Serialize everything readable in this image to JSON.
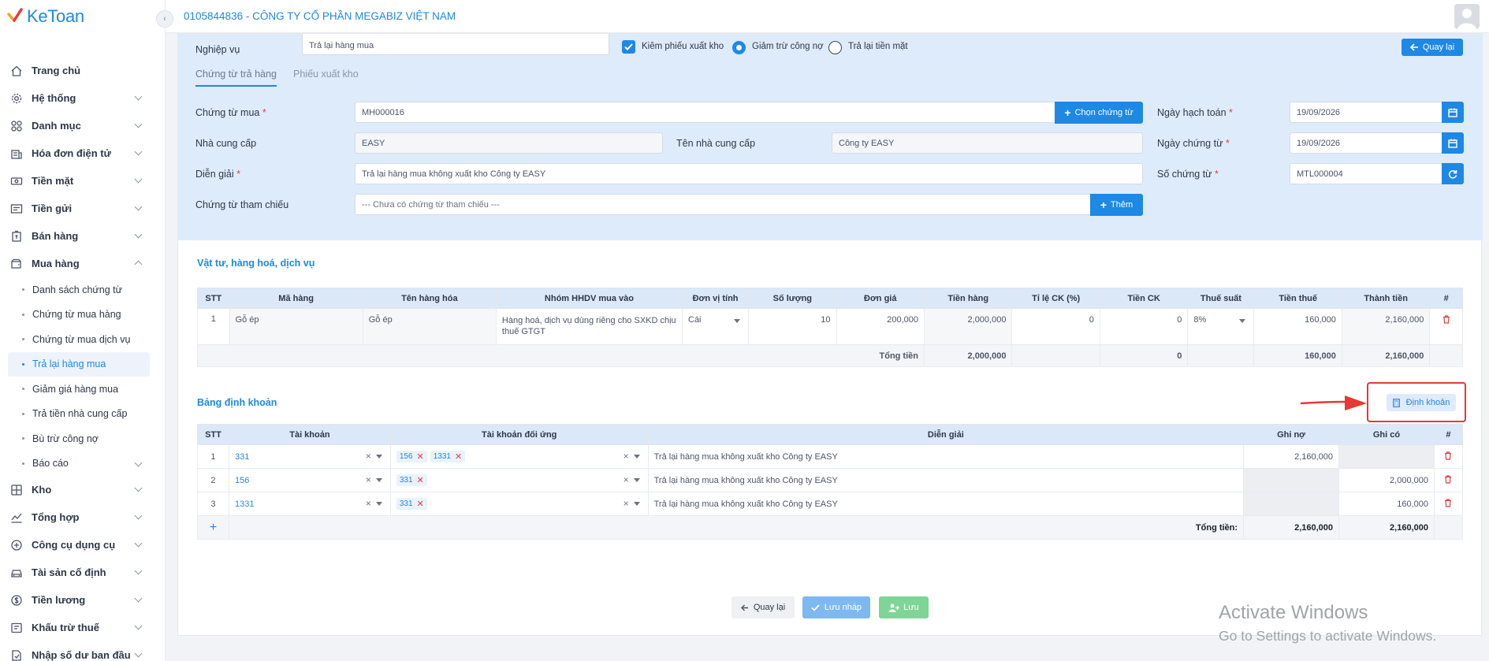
{
  "app": {
    "logo_text": "KeToan",
    "company_title": "0105844836 - CÔNG TY CỔ PHẦN MEGABIZ VIỆT NAM"
  },
  "sidebar": {
    "items": [
      {
        "label": "Trang chủ",
        "icon": "home-icon"
      },
      {
        "label": "Hệ thống",
        "icon": "gear-icon"
      },
      {
        "label": "Danh mục",
        "icon": "grid-icon"
      },
      {
        "label": "Hóa đơn điện tử",
        "icon": "invoice-icon"
      },
      {
        "label": "Tiền mặt",
        "icon": "cash-icon"
      },
      {
        "label": "Tiền gửi",
        "icon": "bank-icon"
      },
      {
        "label": "Bán hàng",
        "icon": "sales-icon"
      },
      {
        "label": "Mua hàng",
        "icon": "purchase-icon"
      }
    ],
    "sub_items": [
      {
        "label": "Danh sách chứng từ"
      },
      {
        "label": "Chứng từ mua hàng"
      },
      {
        "label": "Chứng từ mua dịch vụ"
      },
      {
        "label": "Trả lại hàng mua"
      },
      {
        "label": "Giảm giá hàng mua"
      },
      {
        "label": "Trả tiền nhà cung cấp"
      },
      {
        "label": "Bù trừ công nợ"
      },
      {
        "label": "Báo cáo"
      }
    ],
    "items_after": [
      {
        "label": "Kho",
        "icon": "warehouse-icon"
      },
      {
        "label": "Tổng hợp",
        "icon": "chart-icon"
      },
      {
        "label": "Công cụ dụng cụ",
        "icon": "tools-icon"
      },
      {
        "label": "Tài sản cố định",
        "icon": "asset-icon"
      },
      {
        "label": "Tiền lương",
        "icon": "salary-icon"
      },
      {
        "label": "Khấu trừ thuế",
        "icon": "tax-icon"
      },
      {
        "label": "Nhập số dư ban đầu",
        "icon": "balance-icon"
      }
    ]
  },
  "form": {
    "nghiep_vu_label": "Nghiệp vụ",
    "nghiep_vu_value": "Trả lại hàng mua",
    "kiem_phieu_label": "Kiêm phiếu xuất kho",
    "giam_tru_label": "Giảm trừ công nợ",
    "tra_lai_label": "Trả lại tiền mặt",
    "back_top_label": "Quay lại",
    "tabs": [
      "Chứng từ trả hàng",
      "Phiếu xuất kho"
    ],
    "chung_tu_mua_label": "Chứng từ mua",
    "chung_tu_mua_value": "MH000016",
    "chon_chung_tu_label": "Chọn chứng từ",
    "ngay_hach_toan_label": "Ngày hạch toán",
    "ngay_hach_toan_value": "19/09/2026",
    "nha_cung_cap_label": "Nhà cung cấp",
    "nha_cung_cap_value": "EASY",
    "ten_ncc_label": "Tên nhà cung cấp",
    "ten_ncc_value": "Công ty EASY",
    "ngay_chung_tu_label": "Ngày chứng từ",
    "ngay_chung_tu_value": "19/09/2026",
    "dien_giai_label": "Diễn giải",
    "dien_giai_value": "Trả lại hàng mua không xuất kho Công ty EASY",
    "so_chung_tu_label": "Số chứng từ",
    "so_chung_tu_value": "MTL000004",
    "tham_chieu_label": "Chứng từ tham chiếu",
    "tham_chieu_value": "--- Chưa có chứng từ tham chiếu ---",
    "them_label": "Thêm",
    "required_mark": "*"
  },
  "goods": {
    "title": "Vật tư, hàng hoá, dịch vụ",
    "headers": [
      "STT",
      "Mã hàng",
      "Tên hàng hóa",
      "Nhóm HHDV mua vào",
      "Đơn vị tính",
      "Số lượng",
      "Đơn giá",
      "Tiền hàng",
      "Tỉ lệ CK (%)",
      "Tiền CK",
      "Thuế suất",
      "Tiền thuế",
      "Thành tiền",
      "#"
    ],
    "row": {
      "stt": "1",
      "ma": "Gỗ ép",
      "ten": "Gỗ ép",
      "nhom": "Hàng hoá, dịch vụ dùng riêng cho SXKD chịu thuế GTGT",
      "dvt": "Cái",
      "sl": "10",
      "dongia": "200,000",
      "tienhang": "2,000,000",
      "tlck": "0",
      "tienck": "0",
      "thuesuat": "8%",
      "tienthue": "160,000",
      "thanhtien": "2,160,000"
    },
    "total": {
      "label": "Tổng tiền",
      "tienhang": "2,000,000",
      "tienck": "0",
      "tienthue": "160,000",
      "thanhtien": "2,160,000"
    }
  },
  "entries": {
    "title": "Bảng định khoản",
    "dinh_khoan_label": "Định khoản",
    "headers": [
      "STT",
      "Tài khoản",
      "Tài khoản đối ứng",
      "Diễn giải",
      "Ghi nợ",
      "Ghi có",
      "#"
    ],
    "rows": [
      {
        "stt": "1",
        "tk": "331",
        "doi_ung": [
          "156",
          "1331"
        ],
        "dien_giai": "Trả lại hàng mua không xuất kho Công ty EASY",
        "no": "2,160,000",
        "co": ""
      },
      {
        "stt": "2",
        "tk": "156",
        "doi_ung": [
          "331"
        ],
        "dien_giai": "Trả lại hàng mua không xuất kho Công ty EASY",
        "no": "",
        "co": "2,000,000"
      },
      {
        "stt": "3",
        "tk": "1331",
        "doi_ung": [
          "331"
        ],
        "dien_giai": "Trả lại hàng mua không xuất kho Công ty EASY",
        "no": "",
        "co": "160,000"
      }
    ],
    "add_label": "+",
    "total_label": "Tổng tiền:",
    "total_no": "2,160,000",
    "total_co": "2,160,000"
  },
  "footer": {
    "back": "Quay lại",
    "draft": "Lưu nháp",
    "save": "Lưu"
  },
  "watermark": {
    "line1": "Activate Windows",
    "line2": "Go to Settings to activate Windows."
  },
  "colors": {
    "primary": "#1e88e5",
    "danger": "#e53e3e",
    "form_bg": "#deebfb",
    "header_bg": "#dbe8f8"
  }
}
